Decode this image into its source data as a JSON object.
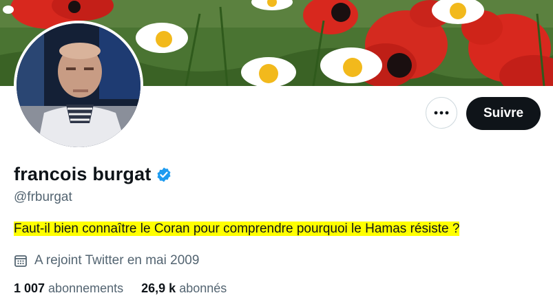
{
  "profile": {
    "name": "francois burgat",
    "handle": "@frburgat",
    "bio": "Faut-il bien connaître le Coran pour comprendre pourquoi le Hamas résiste ?",
    "joined": "A rejoint Twitter en mai 2009",
    "following_count": "1 007",
    "following_label": "abonnements",
    "followers_count": "26,9 k",
    "followers_label": "abonnés"
  },
  "actions": {
    "follow_label": "Suivre",
    "more_icon": "more-dots-icon"
  },
  "icons": {
    "verified": "verified-badge-icon",
    "calendar": "calendar-icon"
  },
  "colors": {
    "verified_blue": "#1d9bf0",
    "bio_highlight": "#ffff00",
    "follow_button": "#0f1419",
    "secondary_text": "#536471"
  }
}
